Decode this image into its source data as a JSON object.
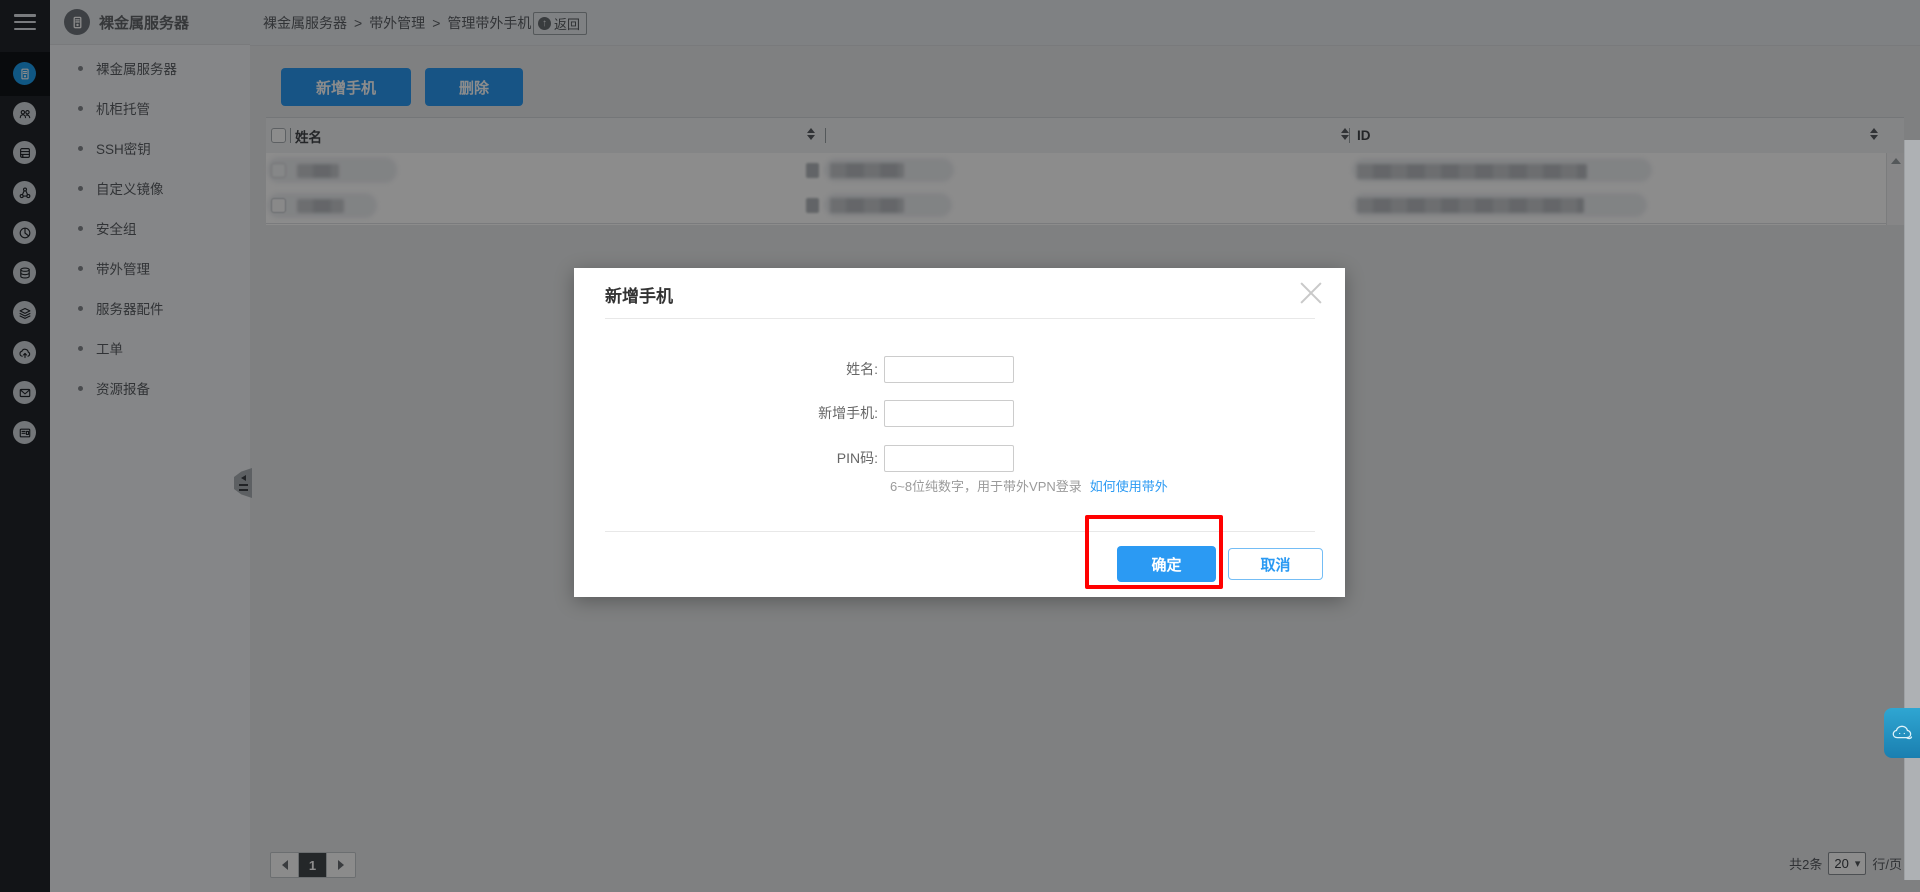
{
  "app": {
    "title": "裸金属服务器"
  },
  "breadcrumb": {
    "items": [
      "裸金属服务器",
      "带外管理",
      "管理带外手机"
    ],
    "separator": ">",
    "back_label": "返回"
  },
  "rail": {
    "icons": [
      "menu-icon",
      "server-icon",
      "team-icon",
      "rack-icon",
      "topology-icon",
      "pie-icon",
      "database-icon",
      "layers-icon",
      "cloud-upload-icon",
      "mail-icon",
      "card-icon"
    ],
    "active_icon": "server-icon"
  },
  "sidebar": {
    "items": [
      {
        "label": "裸金属服务器"
      },
      {
        "label": "机柜托管"
      },
      {
        "label": "SSH密钥"
      },
      {
        "label": "自定义镜像"
      },
      {
        "label": "安全组"
      },
      {
        "label": "带外管理"
      },
      {
        "label": "服务器配件"
      },
      {
        "label": "工单"
      },
      {
        "label": "资源报备"
      }
    ]
  },
  "toolbar": {
    "add_label": "新增手机",
    "delete_label": "删除"
  },
  "table": {
    "columns": [
      {
        "label": "姓名"
      },
      {
        "label": ""
      },
      {
        "label": "ID"
      }
    ],
    "rows": [
      {
        "redacted": true
      },
      {
        "redacted": true
      }
    ]
  },
  "pagination": {
    "current": "1",
    "total_text": "共2条",
    "page_size": "20",
    "caret": "▾",
    "unit": "行/页"
  },
  "modal": {
    "title": "新增手机",
    "fields": [
      {
        "label": "姓名:"
      },
      {
        "label": "新增手机:"
      },
      {
        "label": "PIN码:"
      }
    ],
    "hint": "6~8位纯数字，用于带外VPN登录",
    "hint_link": "如何使用带外",
    "confirm_label": "确定",
    "cancel_label": "取消"
  },
  "colors": {
    "accent_blue": "#2b9af3",
    "active_icon_blue": "#1e9fef",
    "annotation_red": "#ff0000",
    "rail_bg": "#22262a",
    "mascot_blue": "#2395c5"
  }
}
